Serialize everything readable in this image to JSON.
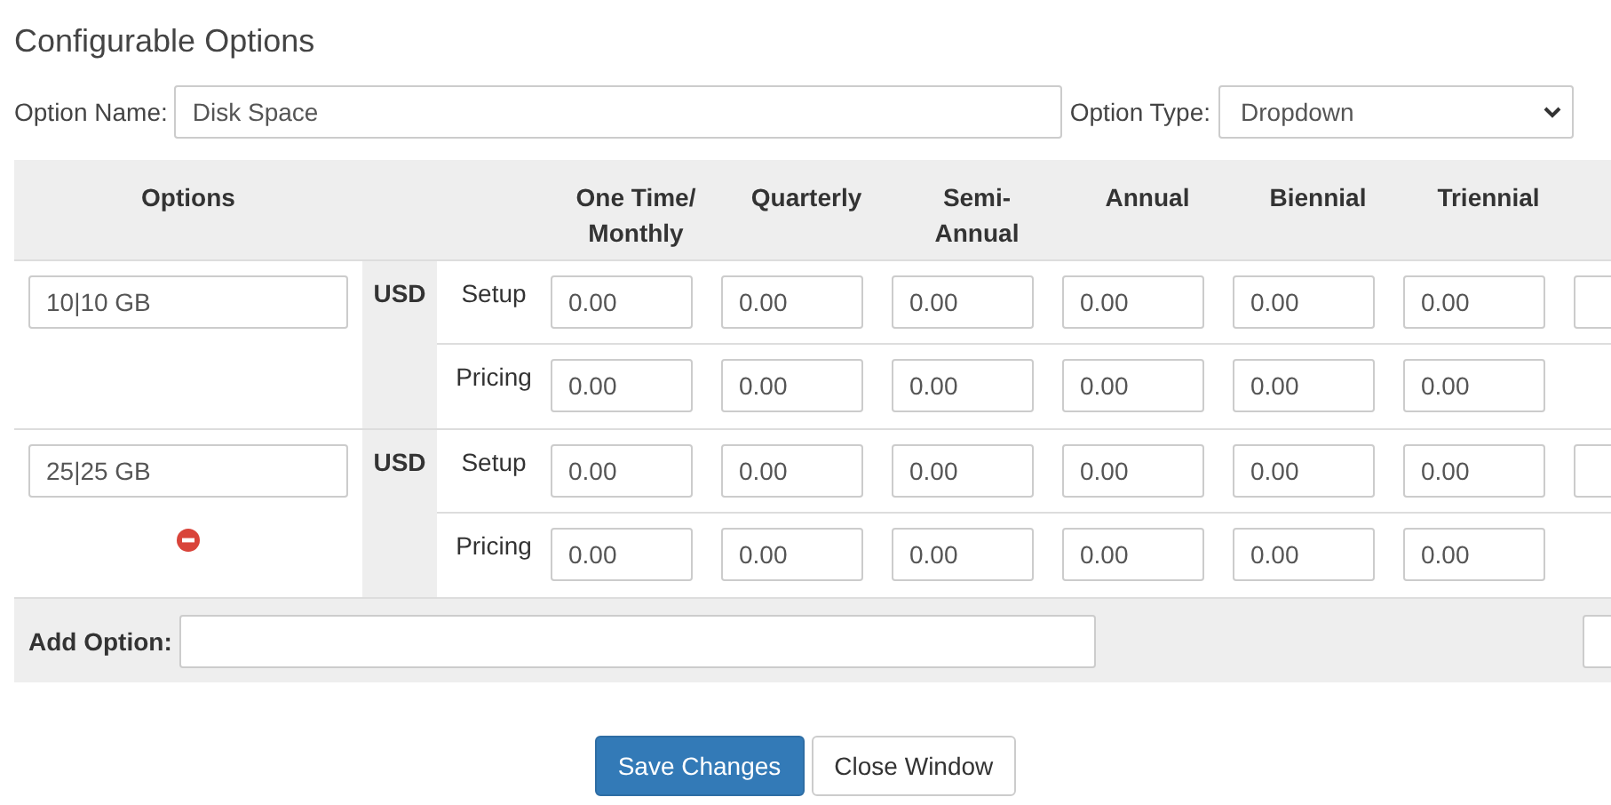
{
  "title": "Configurable Options",
  "option_name": {
    "label": "Option Name:",
    "value": "Disk Space"
  },
  "option_type": {
    "label": "Option Type:",
    "value": "Dropdown"
  },
  "table": {
    "columns": [
      "Options",
      "One Time/ Monthly",
      "Quarterly",
      "Semi-Annual",
      "Annual",
      "Biennial",
      "Triennial"
    ],
    "rows": [
      {
        "option": "10|10 GB",
        "removable": false,
        "currency": "USD",
        "lines": [
          {
            "label": "Setup",
            "prices": [
              "0.00",
              "0.00",
              "0.00",
              "0.00",
              "0.00",
              "0.00"
            ],
            "cut_field": true
          },
          {
            "label": "Pricing",
            "prices": [
              "0.00",
              "0.00",
              "0.00",
              "0.00",
              "0.00",
              "0.00"
            ],
            "cut_field": false
          }
        ]
      },
      {
        "option": "25|25 GB",
        "removable": true,
        "currency": "USD",
        "lines": [
          {
            "label": "Setup",
            "prices": [
              "0.00",
              "0.00",
              "0.00",
              "0.00",
              "0.00",
              "0.00"
            ],
            "cut_field": true
          },
          {
            "label": "Pricing",
            "prices": [
              "0.00",
              "0.00",
              "0.00",
              "0.00",
              "0.00",
              "0.00"
            ],
            "cut_field": false
          }
        ]
      }
    ],
    "add_option": {
      "label": "Add Option:",
      "cut_field": true
    }
  },
  "buttons": [
    {
      "label": "Save Changes",
      "kind": "primary"
    },
    {
      "label": "Close Window",
      "kind": "default"
    }
  ]
}
